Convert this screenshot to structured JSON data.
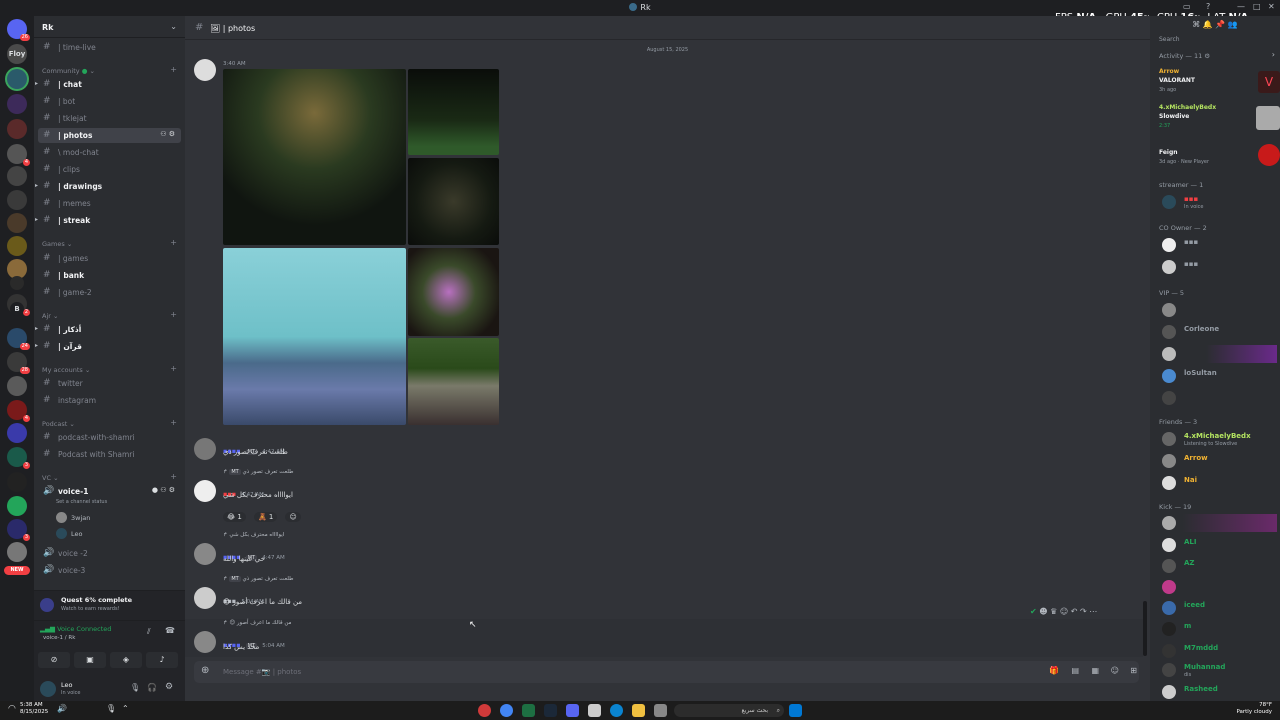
{
  "window": {
    "title": "Rk"
  },
  "overlay": {
    "fps_label": "FPS",
    "fps_value": "N/A",
    "gpu_label": "GPU",
    "gpu_value": "45",
    "gpu_unit": "%",
    "cpu_label": "CPU",
    "cpu_value": "16",
    "cpu_unit": "%",
    "lat_label": "LAT",
    "lat_value": "N/A"
  },
  "servers": [
    {
      "badge": "26"
    },
    {
      "label": "Floy"
    },
    {},
    {},
    {},
    {
      "badge": "4"
    },
    {},
    {},
    {},
    {},
    {},
    {},
    {
      "badge": "2"
    },
    {},
    {
      "label": "B"
    },
    {
      "badge": "24"
    },
    {
      "badge": "28"
    },
    {},
    {
      "badge": "4"
    },
    {},
    {
      "badge": "3"
    },
    {},
    {},
    {
      "badge": "3"
    },
    {},
    {
      "label": "NEW"
    }
  ],
  "sidebar": {
    "guild_name": "Rk",
    "top_channel": "| time-live",
    "categories": {
      "community": "Community",
      "games": "Games",
      "ajr": "Ajr",
      "accounts": "My accounts",
      "podcast": "Podcast",
      "vc": "VC"
    },
    "community_channels": [
      "| chat",
      "| bot",
      "| tklejat",
      "| photos",
      "\\ mod-chat",
      "| clips",
      "| drawings",
      "| memes",
      "| streak"
    ],
    "games_channels": [
      "| games",
      "| bank",
      "| game-2"
    ],
    "ajr_channels": [
      "| أذكار",
      "| قرآن"
    ],
    "account_channels": [
      "twitter",
      "instagram"
    ],
    "podcast_channels": [
      "podcast-with-shamri",
      "Podcast with Shamri"
    ],
    "voice_channels": {
      "v1": "voice-1",
      "v1_status": "Set a channel status",
      "v2": "voice -2",
      "v3": "voice-3"
    },
    "voice_users": [
      "3wjan",
      "Leo"
    ]
  },
  "quest": {
    "title": "Quest 6% complete",
    "subtitle": "Watch to earn rewards!"
  },
  "voice": {
    "status": "Voice Connected",
    "channel": "voice-1 / Rk"
  },
  "user": {
    "name": "Leo",
    "status": "In voice"
  },
  "chat": {
    "channel_title": "| photos",
    "date_divider": "August 15, 2025",
    "first_time": "3:40 AM",
    "messages": [
      {
        "tag": "MT",
        "time": "4:42 AM",
        "text": "طلعت تعرف تصور ذي"
      },
      {
        "reply": "طلعت تعرف تصور ذي",
        "reply_tag": "MT",
        "time": "4:47 AM",
        "text": "ايوااااه محترف بكل شي",
        "reactions": [
          "1",
          "1"
        ]
      },
      {
        "reply": "ايوااااه محترف بكل شي",
        "tag": "MT",
        "time": "4:47 AM",
        "text": "حي عينها والله"
      },
      {
        "reply": "طلعت تعرف تصور ذي",
        "reply_tag": "MT",
        "time": "5:04 AM",
        "text": "من قالك ما اعرف أصور"
      },
      {
        "reply": "من قالك ما اعرف أصور",
        "tag": "MT",
        "time": "5:04 AM",
        "text": "محد يس كذا"
      }
    ],
    "composer_placeholder": "Message #📷 | photos"
  },
  "members": {
    "search": "Search",
    "activity_header": "Activity — 11",
    "activities": [
      {
        "name": "Arrow",
        "game": "VALORANT",
        "meta": "3h ago"
      },
      {
        "name": "4.xMichaelyBedx",
        "game": "Slowdive",
        "meta": "2:37"
      },
      {
        "name": "",
        "game": "Feign",
        "meta": "3d ago · New Player"
      }
    ],
    "streamer_header": "streamer — 1",
    "streamer_sub": "In voice",
    "co_owner_header": "CO Owner — 2",
    "vip_header": "VIP — 5",
    "vip": [
      "",
      "Corleone",
      "",
      "loSultan",
      ""
    ],
    "friends_header": "Friends — 3",
    "friends": [
      {
        "name": "4.xMichaelyBedx",
        "sub": "Listening to Slowdive"
      },
      {
        "name": "Arrow",
        "sub": ""
      },
      {
        "name": "Nai",
        "sub": ""
      }
    ],
    "kick_header": "Kick — 19",
    "kick": [
      {
        "name": "",
        "sub": ""
      },
      {
        "name": "ALI",
        "sub": ""
      },
      {
        "name": "AZ",
        "sub": ""
      },
      {
        "name": "",
        "sub": ""
      },
      {
        "name": "iceed",
        "sub": ""
      },
      {
        "name": "m",
        "sub": ""
      },
      {
        "name": "M7mddd",
        "sub": ""
      },
      {
        "name": "Muhannad",
        "sub": "dis"
      },
      {
        "name": "Rasheed",
        "sub": ""
      }
    ]
  },
  "taskbar": {
    "time": "5:38 AM",
    "date": "8/15/2025",
    "weather_temp": "78°F",
    "weather_desc": "Partly cloudy",
    "search_text": "بحث سريع"
  }
}
